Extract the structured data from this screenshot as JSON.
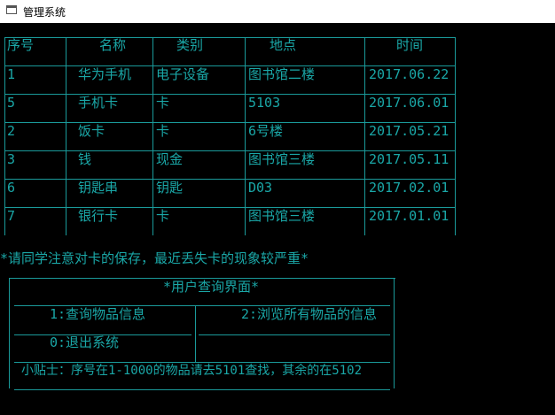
{
  "window": {
    "title": "管理系统"
  },
  "table": {
    "headers": [
      "序号",
      "名称",
      "类别",
      "地点",
      "时间"
    ],
    "rows": [
      [
        "1",
        "华为手机",
        "电子设备",
        "图书馆二楼",
        "2017.06.22"
      ],
      [
        "5",
        "手机卡",
        "卡",
        "5103",
        "2017.06.01"
      ],
      [
        "2",
        "饭卡",
        "卡",
        "6号楼",
        "2017.05.21"
      ],
      [
        "3",
        "钱",
        "现金",
        "图书馆三楼",
        "2017.05.11"
      ],
      [
        "6",
        "钥匙串",
        "钥匙",
        "D03",
        "2017.02.01"
      ],
      [
        "7",
        "银行卡",
        "卡",
        "图书馆三楼",
        "2017.01.01"
      ]
    ]
  },
  "notice": "*请同学注意对卡的保存，最近丢失卡的现象较严重*",
  "menu": {
    "title": "*用户查询界面*",
    "option1": "1:查询物品信息",
    "option2": "2:浏览所有物品的信息",
    "option0": "0:退出系统",
    "tip": "小贴士：序号在1-1000的物品请去5101查找，其余的在5102"
  },
  "colors": {
    "console_bg": "#000000",
    "console_text": "#1aa7a7",
    "titlebar_bg": "#ffffff"
  }
}
